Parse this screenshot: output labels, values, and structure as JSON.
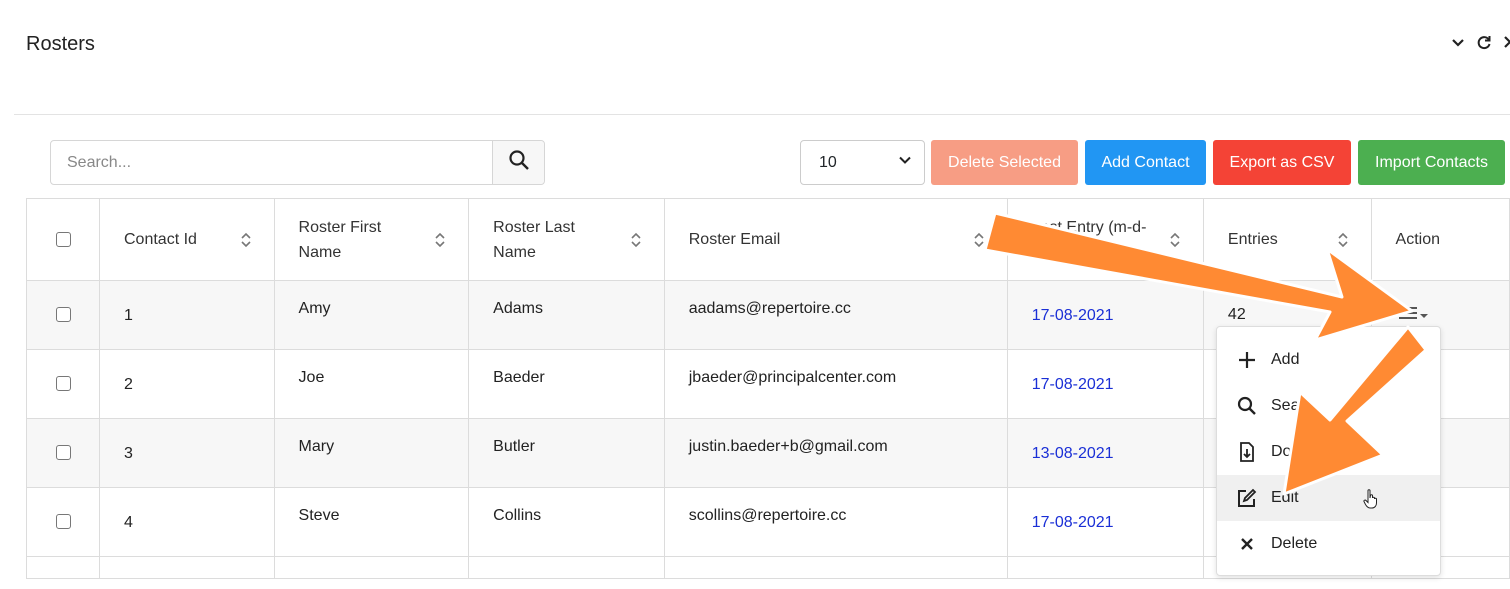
{
  "panel": {
    "title": "Rosters"
  },
  "search": {
    "placeholder": "Search..."
  },
  "page_size": {
    "selected": "10"
  },
  "toolbar": {
    "delete_label": "Delete Selected",
    "add_label": "Add Contact",
    "export_label": "Export as CSV",
    "import_label": "Import Contacts"
  },
  "table": {
    "headers": [
      "Contact Id",
      "Roster First Name",
      "Roster Last Name",
      "Roster Email",
      "Last Entry (m-d-",
      "Entries",
      "Action"
    ],
    "rows": [
      {
        "id": "1",
        "first": "Amy",
        "last": "Adams",
        "email": "aadams@repertoire.cc",
        "date": "17-08-2021",
        "entries": "42"
      },
      {
        "id": "2",
        "first": "Joe",
        "last": "Baeder",
        "email": "jbaeder@principalcenter.com",
        "date": "17-08-2021",
        "entries": ""
      },
      {
        "id": "3",
        "first": "Mary",
        "last": "Butler",
        "email": "justin.baeder+b@gmail.com",
        "date": "13-08-2021",
        "entries": ""
      },
      {
        "id": "4",
        "first": "Steve",
        "last": "Collins",
        "email": "scollins@repertoire.cc",
        "date": "17-08-2021",
        "entries": ""
      }
    ]
  },
  "action_menu": {
    "items": [
      {
        "label": "Add",
        "icon": "plus-icon"
      },
      {
        "label": "Sear",
        "icon": "search-icon"
      },
      {
        "label": "Dow",
        "icon": "download-file-icon"
      },
      {
        "label": "Edit",
        "icon": "edit-icon"
      },
      {
        "label": "Delete",
        "icon": "times-icon"
      }
    ]
  },
  "colors": {
    "delete": "#f79d84",
    "add": "#2196f3",
    "export": "#f44336",
    "import": "#4caf50",
    "date_link": "#1a2fd6",
    "annotation_arrow": "#ff8a33"
  }
}
